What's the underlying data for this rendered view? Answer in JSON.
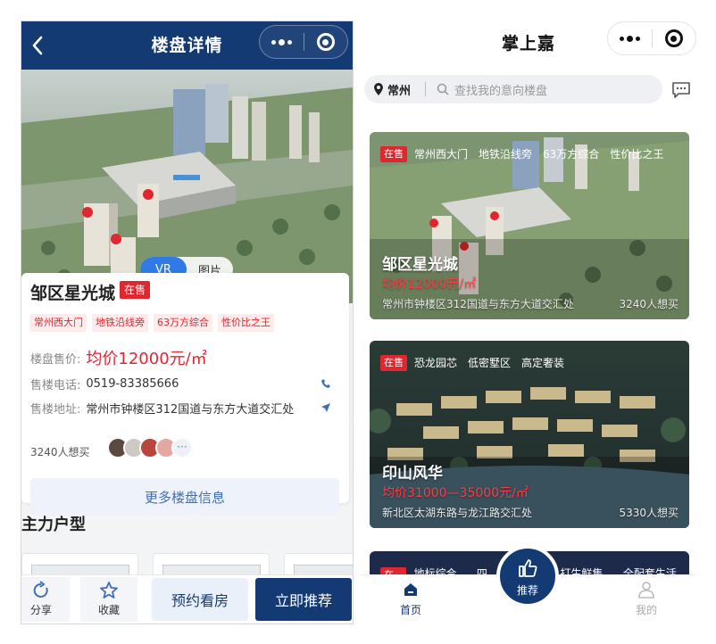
{
  "left": {
    "header": {
      "title": "楼盘详情"
    },
    "hero": {
      "toggle": {
        "vr": "VR",
        "photo": "图片"
      }
    },
    "property": {
      "name": "邹区星光城",
      "status": "在售",
      "tags": [
        "常州西大门",
        "地铁沿线旁",
        "63万方综合",
        "性价比之王"
      ],
      "price_label": "楼盘售价:",
      "price": "均价12000元/㎡",
      "phone_label": "售楼电话:",
      "phone": "0519-83385666",
      "address_label": "售楼地址:",
      "address": "常州市钟楼区312国道与东方大道交汇处",
      "want": "3240人想买",
      "more_button": "更多楼盘信息"
    },
    "section_title": "主力户型",
    "bottom_bar": {
      "share": "分享",
      "favorite": "收藏",
      "book": "预约看房",
      "recommend": "立即推荐"
    }
  },
  "right": {
    "header": {
      "title": "掌上嘉"
    },
    "search": {
      "city": "常州",
      "placeholder": "查找我的意向楼盘"
    },
    "listings": [
      {
        "status": "在售",
        "tags": [
          "常州西大门",
          "地铁沿线旁",
          "63万方综合",
          "性价比之王"
        ],
        "name": "邹区星光城",
        "price": "均价12000元/㎡",
        "address": "常州市钟楼区312国道与东方大道交汇处",
        "want": "3240人想买"
      },
      {
        "status": "在售",
        "tags": [
          "恐龙园芯",
          "低密墅区",
          "高定奢装"
        ],
        "name": "印山风华",
        "price": "均价31000—35000元/㎡",
        "address": "新北区太湖东路与龙江路交汇处",
        "want": "5330人想买"
      },
      {
        "status": "在售",
        "tags": [
          "地标综合体",
          "四大",
          "打生鲜集市",
          "全配套生活圈"
        ]
      }
    ],
    "tabbar": {
      "home": "首页",
      "recommend": "推荐",
      "mine": "我的"
    }
  },
  "colors": {
    "navy": "#143a73",
    "accent_red": "#e0262f",
    "link_blue": "#2f7ae5"
  }
}
